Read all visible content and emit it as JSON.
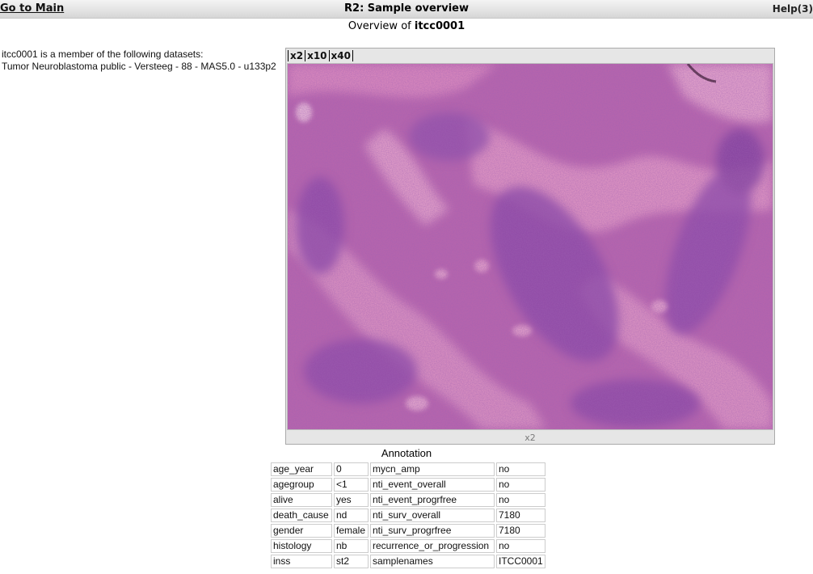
{
  "header": {
    "home_link": "Go to Main",
    "title": "R2: Sample overview",
    "help_link": "Help(3)"
  },
  "subtitle": {
    "prefix": "Overview of",
    "sample": "itcc0001"
  },
  "membership": {
    "intro": "itcc0001 is a member of the following datasets:",
    "datasets": [
      "Tumor Neuroblastoma public - Versteeg - 88 - MAS5.0 - u133p2"
    ]
  },
  "viewer": {
    "zoom_levels": [
      "x2",
      "x10",
      "x40"
    ],
    "current_zoom": "x2",
    "image_subject": "H&E stained neuroblastoma tissue section",
    "colors": {
      "stain_base": "#b15aa9",
      "stain_pink": "#e6a0c8",
      "stain_dark": "#7a3c95"
    }
  },
  "annotation": {
    "title": "Annotation",
    "left": [
      {
        "key": "age_year",
        "value": "0"
      },
      {
        "key": "agegroup",
        "value": "<1"
      },
      {
        "key": "alive",
        "value": "yes"
      },
      {
        "key": "death_cause",
        "value": "nd"
      },
      {
        "key": "gender",
        "value": "female"
      },
      {
        "key": "histology",
        "value": "nb"
      },
      {
        "key": "inss",
        "value": "st2"
      }
    ],
    "right": [
      {
        "key": "mycn_amp",
        "value": "no"
      },
      {
        "key": "nti_event_overall",
        "value": "no"
      },
      {
        "key": "nti_event_progrfree",
        "value": "no"
      },
      {
        "key": "nti_surv_overall",
        "value": "7180"
      },
      {
        "key": "nti_surv_progrfree",
        "value": "7180"
      },
      {
        "key": "recurrence_or_progression",
        "value": "no"
      },
      {
        "key": "samplenames",
        "value": "ITCC0001"
      }
    ]
  }
}
